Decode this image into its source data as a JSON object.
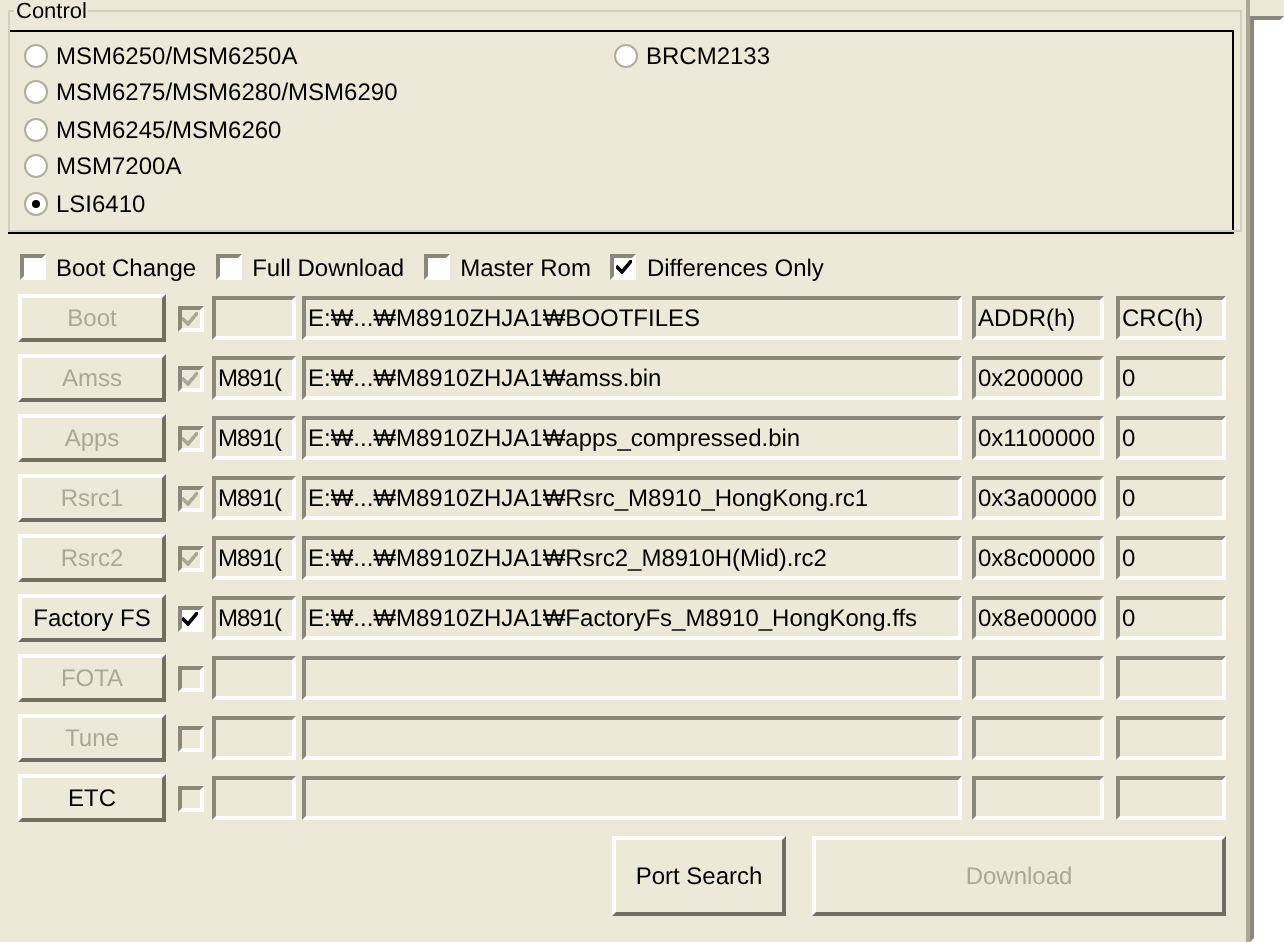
{
  "control": {
    "title": "Control",
    "radio_columns": [
      {
        "radios": [
          {
            "label": "MSM6250/MSM6250A",
            "selected": false
          },
          {
            "label": "MSM6275/MSM6280/MSM6290",
            "selected": false
          },
          {
            "label": "MSM6245/MSM6260",
            "selected": false
          },
          {
            "label": "MSM7200A",
            "selected": false
          },
          {
            "label": "LSI6410",
            "selected": true
          }
        ]
      },
      {
        "radios": [
          {
            "label": "BRCM2133",
            "selected": false
          }
        ]
      }
    ]
  },
  "options": [
    {
      "label": "Boot Change",
      "checked": false
    },
    {
      "label": "Full Download",
      "checked": false
    },
    {
      "label": "Master Rom",
      "checked": false
    },
    {
      "label": "Differences Only",
      "checked": true
    }
  ],
  "rows": [
    {
      "label": "Boot",
      "disabled": true,
      "checked": true,
      "check_disabled": true,
      "short": "",
      "path": "E:₩...₩M8910ZHJA1₩BOOTFILES",
      "addr": "ADDR(h)",
      "crc": "CRC(h)"
    },
    {
      "label": "Amss",
      "disabled": true,
      "checked": true,
      "check_disabled": true,
      "short": "M891(",
      "path": "E:₩...₩M8910ZHJA1₩amss.bin",
      "addr": "0x200000",
      "crc": "0"
    },
    {
      "label": "Apps",
      "disabled": true,
      "checked": true,
      "check_disabled": true,
      "short": "M891(",
      "path": "E:₩...₩M8910ZHJA1₩apps_compressed.bin",
      "addr": "0x1100000",
      "crc": "0"
    },
    {
      "label": "Rsrc1",
      "disabled": true,
      "checked": true,
      "check_disabled": true,
      "short": "M891(",
      "path": "E:₩...₩M8910ZHJA1₩Rsrc_M8910_HongKong.rc1",
      "addr": "0x3a00000",
      "crc": "0"
    },
    {
      "label": "Rsrc2",
      "disabled": true,
      "checked": true,
      "check_disabled": true,
      "short": "M891(",
      "path": "E:₩...₩M8910ZHJA1₩Rsrc2_M8910H(Mid).rc2",
      "addr": "0x8c00000",
      "crc": "0"
    },
    {
      "label": "Factory FS",
      "disabled": false,
      "checked": true,
      "check_disabled": false,
      "short": "M891(",
      "path": "E:₩...₩M8910ZHJA1₩FactoryFs_M8910_HongKong.ffs",
      "addr": "0x8e00000",
      "crc": "0"
    },
    {
      "label": "FOTA",
      "disabled": true,
      "checked": false,
      "check_disabled": true
    },
    {
      "label": "Tune",
      "disabled": true,
      "checked": false,
      "check_disabled": true
    },
    {
      "label": "ETC",
      "disabled": false,
      "checked": false,
      "check_disabled": true
    }
  ],
  "buttons": [
    {
      "label": "Port Search",
      "disabled": false
    },
    {
      "label": "Download",
      "disabled": true
    }
  ]
}
